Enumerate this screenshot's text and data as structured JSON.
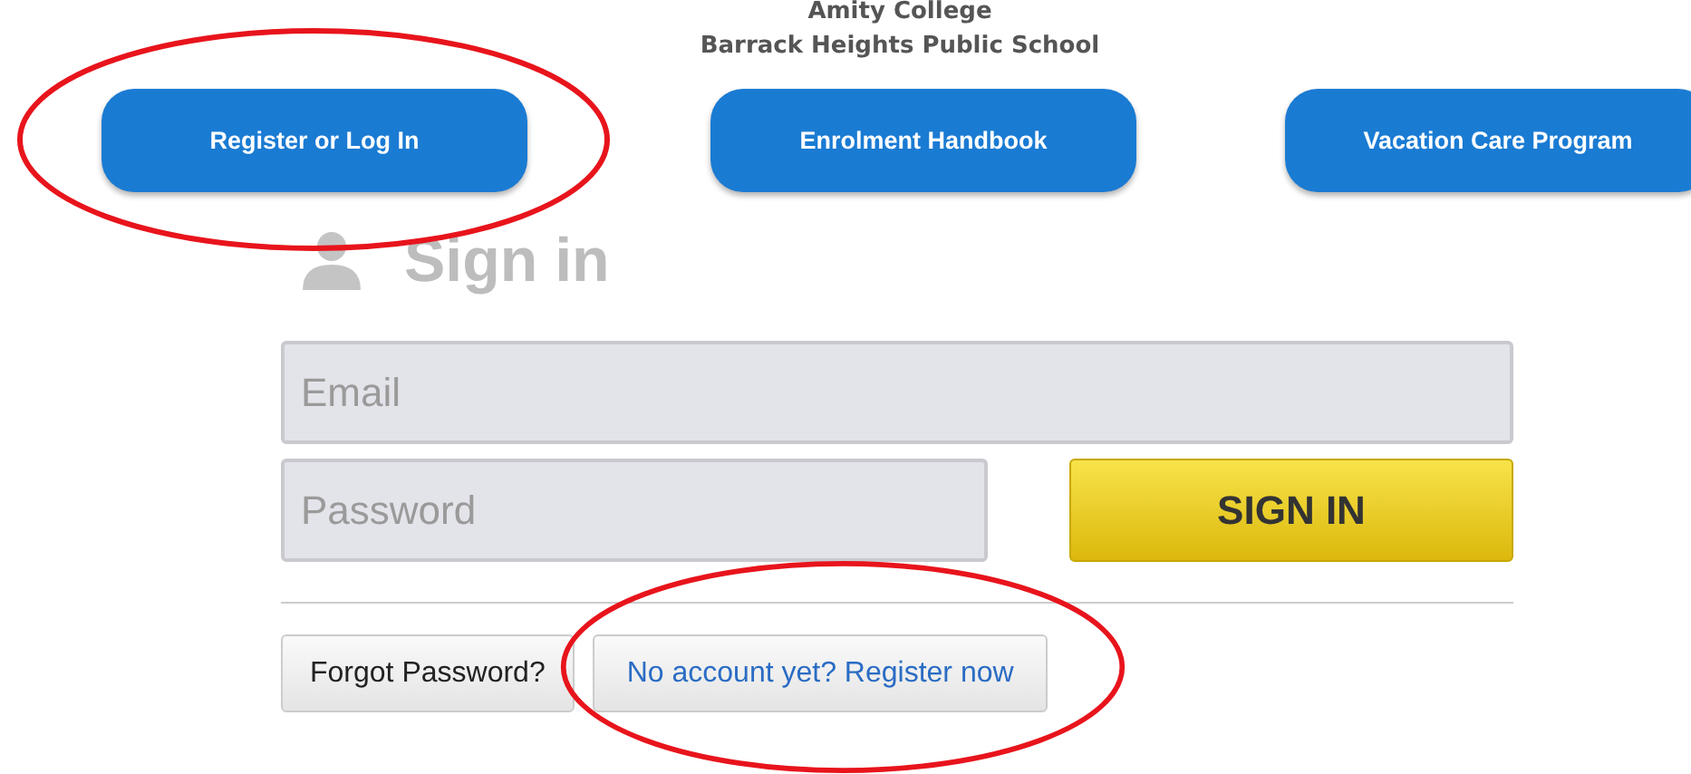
{
  "header": {
    "lines": [
      "Amity College",
      "Barrack Heights Public School"
    ]
  },
  "nav_buttons": [
    {
      "label": "Register or Log In",
      "circled": true
    },
    {
      "label": "Enrolment Handbook",
      "circled": false
    },
    {
      "label": "Vacation Care Program",
      "circled": false
    }
  ],
  "sign_in": {
    "title": "Sign in",
    "email": {
      "placeholder": "Email"
    },
    "password": {
      "placeholder": "Password"
    },
    "submit": "SIGN IN",
    "links": [
      {
        "label": "Forgot Password?",
        "kind": "plain",
        "circled": false
      },
      {
        "label": "No account yet? Register now",
        "kind": "link",
        "circled": true
      }
    ]
  }
}
